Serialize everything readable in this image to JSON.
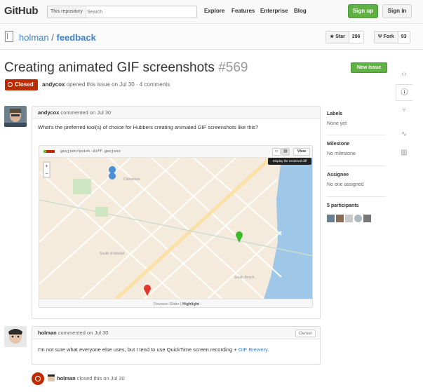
{
  "header": {
    "logo": "GitHub",
    "search_scope": "This repository",
    "search_placeholder": "Search",
    "nav": [
      "Explore",
      "Features",
      "Enterprise",
      "Blog"
    ],
    "signup": "Sign up",
    "signin": "Sign in"
  },
  "repo": {
    "owner": "holman",
    "sep": " / ",
    "name": "feedback",
    "star_label": "Star",
    "star_count": "296",
    "fork_label": "Fork",
    "fork_count": "93"
  },
  "issue": {
    "title": "Creating animated GIF screenshots",
    "number": "#569",
    "new_issue": "New issue",
    "state": "Closed",
    "author": "andycox",
    "meta_text": " opened this issue on Jul 30 · 4 comments"
  },
  "comments": [
    {
      "author": "andycox",
      "header_text": " commented on Jul 30",
      "body": "What's the preferred tool(s) of choice for Hubbers creating animated GIF screenshots like this?"
    },
    {
      "author": "holman",
      "header_text": " commented on Jul 30",
      "badge": "Owner",
      "body": "I'm not sure what everyone else uses, but I tend to use QuickTime screen recording",
      "body_link_prefix": " + ",
      "body_link": "GIF Brewery",
      "body_suffix": "."
    }
  ],
  "embed": {
    "file": "geojson/point-diff.geojson",
    "view": "View",
    "tooltip": "Display the rendered diff",
    "footer_a": "Revision Slider",
    "footer_sep": " | ",
    "footer_b": "Highlight",
    "map_labels": [
      "Chinatown",
      "South of Market",
      "South Beach"
    ]
  },
  "sidebar": {
    "labels_h": "Labels",
    "labels_v": "None yet",
    "milestone_h": "Milestone",
    "milestone_v": "No milestone",
    "assignee_h": "Assignee",
    "assignee_v": "No one assigned",
    "participants_h": "5 participants"
  },
  "event": {
    "actor": "holman",
    "text": " closed this on Jul 30"
  },
  "colors": {
    "link": "#4183c4",
    "green": "#60b044",
    "closed_red": "#bd2c00"
  }
}
